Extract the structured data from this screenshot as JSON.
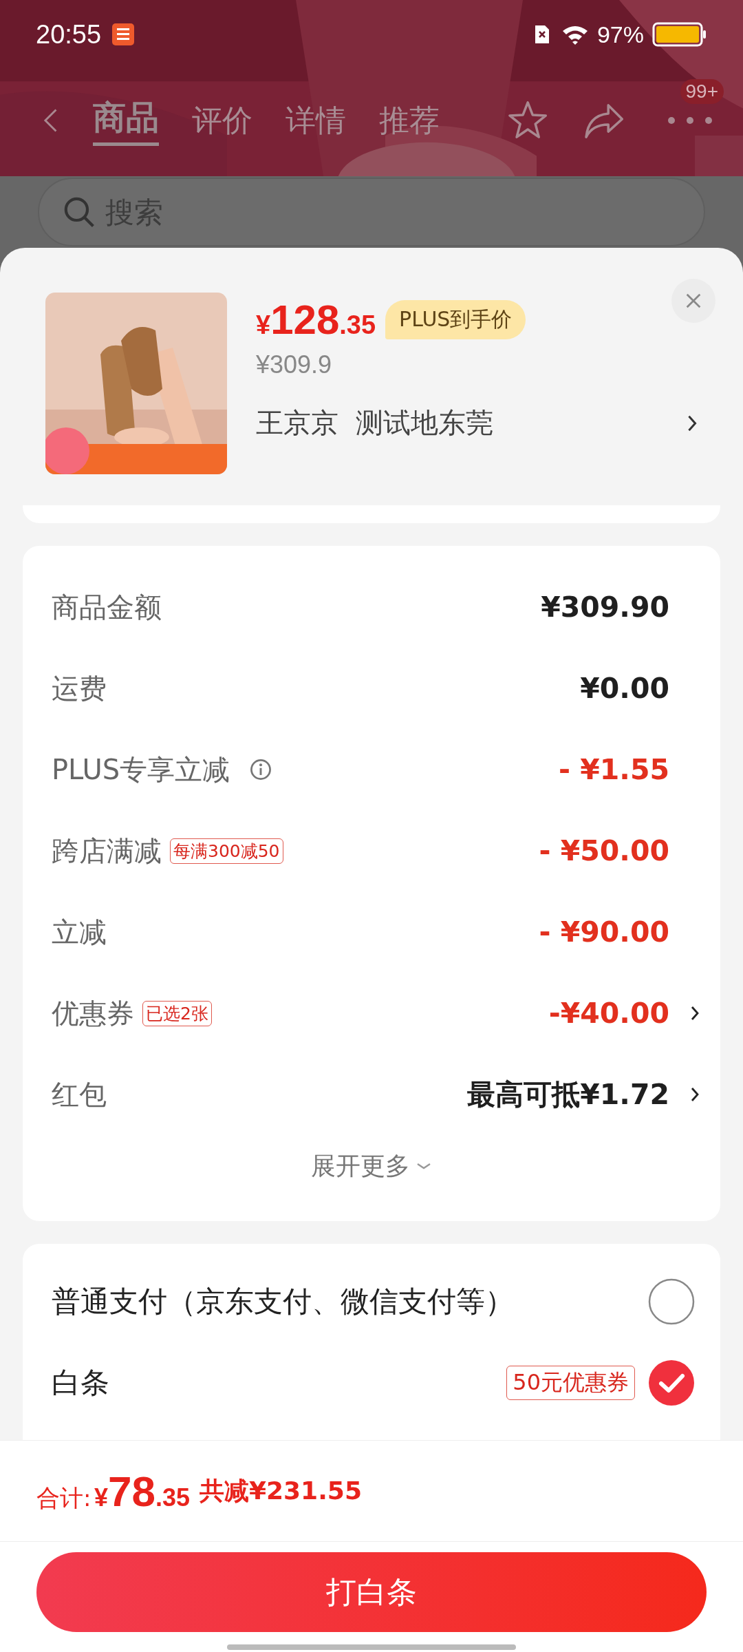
{
  "status_bar": {
    "time": "20:55",
    "battery": "97%"
  },
  "nav": {
    "tabs": [
      {
        "label": "商品",
        "selected": true
      },
      {
        "label": "评价",
        "selected": false
      },
      {
        "label": "详情",
        "selected": false
      },
      {
        "label": "推荐",
        "selected": false
      }
    ],
    "badge": "99+"
  },
  "search": {
    "placeholder": "搜索"
  },
  "product": {
    "currency": "¥",
    "price_int": "128",
    "price_dec": ".35",
    "price_tag": "PLUS到手价",
    "original_price": "¥309.9",
    "address": "王京京  测试地东莞"
  },
  "fees": [
    {
      "kind": "plain",
      "label": "商品金额",
      "info": false,
      "value": "¥309.90",
      "arrow": false
    },
    {
      "kind": "plain",
      "label": "运费",
      "info": false,
      "value": "¥0.00",
      "arrow": false
    },
    {
      "kind": "discount",
      "label": "PLUS专享立减",
      "info": true,
      "value": "- ¥1.55",
      "arrow": false
    },
    {
      "kind": "discount",
      "label": "跨店满减",
      "tag": "每满300减50",
      "info": false,
      "value": "- ¥50.00",
      "arrow": false
    },
    {
      "kind": "discount",
      "label": "立减",
      "info": false,
      "value": "- ¥90.00",
      "arrow": false
    },
    {
      "kind": "discount",
      "label": "优惠券",
      "tag": "已选2张",
      "info": false,
      "value": "-¥40.00",
      "arrow": true
    },
    {
      "kind": "plain",
      "label": "红包",
      "info": false,
      "value": "最高可抵¥1.72",
      "arrow": true
    }
  ],
  "expand": "展开更多",
  "payments": [
    {
      "label": "普通支付（京东支付、微信支付等）",
      "selected": false
    },
    {
      "label": "白条",
      "tag": "50元优惠券",
      "selected": true
    }
  ],
  "total": {
    "label": "合计:",
    "currency": "¥",
    "int": "78",
    "dec": ".35",
    "saving": "共减¥231.55"
  },
  "button": "打白条"
}
